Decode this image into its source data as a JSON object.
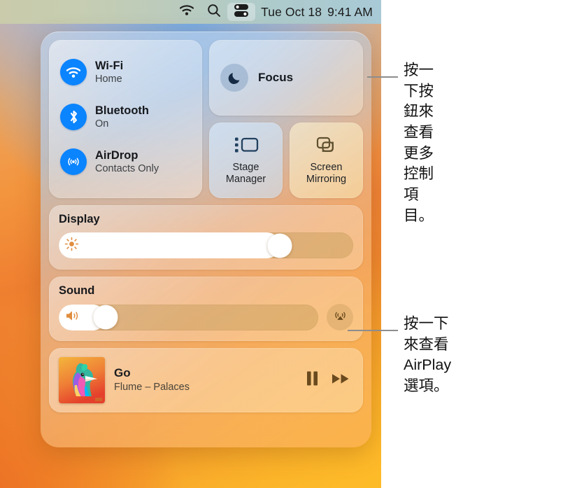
{
  "menubar": {
    "icons": [
      {
        "name": "wifi-icon",
        "label": "Wi-Fi"
      },
      {
        "name": "search-icon",
        "label": "Spotlight Search"
      },
      {
        "name": "control-center-icon",
        "label": "Control Center"
      }
    ],
    "date": "Tue Oct 18",
    "time": "9:41 AM"
  },
  "control_center": {
    "connectivity": [
      {
        "icon": "wifi-icon",
        "title": "Wi-Fi",
        "status": "Home"
      },
      {
        "icon": "bluetooth-icon",
        "title": "Bluetooth",
        "status": "On"
      },
      {
        "icon": "airdrop-icon",
        "title": "AirDrop",
        "status": "Contacts Only"
      }
    ],
    "focus": {
      "icon": "moon-icon",
      "label": "Focus"
    },
    "tiles": [
      {
        "icon": "stage-manager-icon",
        "label": "Stage\nManager"
      },
      {
        "icon": "screen-mirroring-icon",
        "label": "Screen\nMirroring"
      }
    ],
    "display": {
      "title": "Display",
      "icon": "brightness-icon",
      "value": 75
    },
    "sound": {
      "title": "Sound",
      "icon": "speaker-icon",
      "value": 18,
      "airplay_icon": "airplay-audio-icon"
    },
    "now_playing": {
      "artwork": "album-artwork-colorful-bird",
      "title": "Go",
      "subtitle": "Flume – Palaces",
      "controls": [
        {
          "icon": "pause-icon",
          "label": "Pause"
        },
        {
          "icon": "fast-forward-icon",
          "label": "Fast Forward"
        }
      ]
    }
  },
  "annotations": [
    {
      "text": "按一下按鈕來查看\n更多控制項目。"
    },
    {
      "text": "按一下來查看\nAirPlay 選項。"
    }
  ],
  "colors": {
    "accent_blue": "#0a84ff",
    "leader_line": "#8d8d8d",
    "text_primary": "#16181c"
  }
}
